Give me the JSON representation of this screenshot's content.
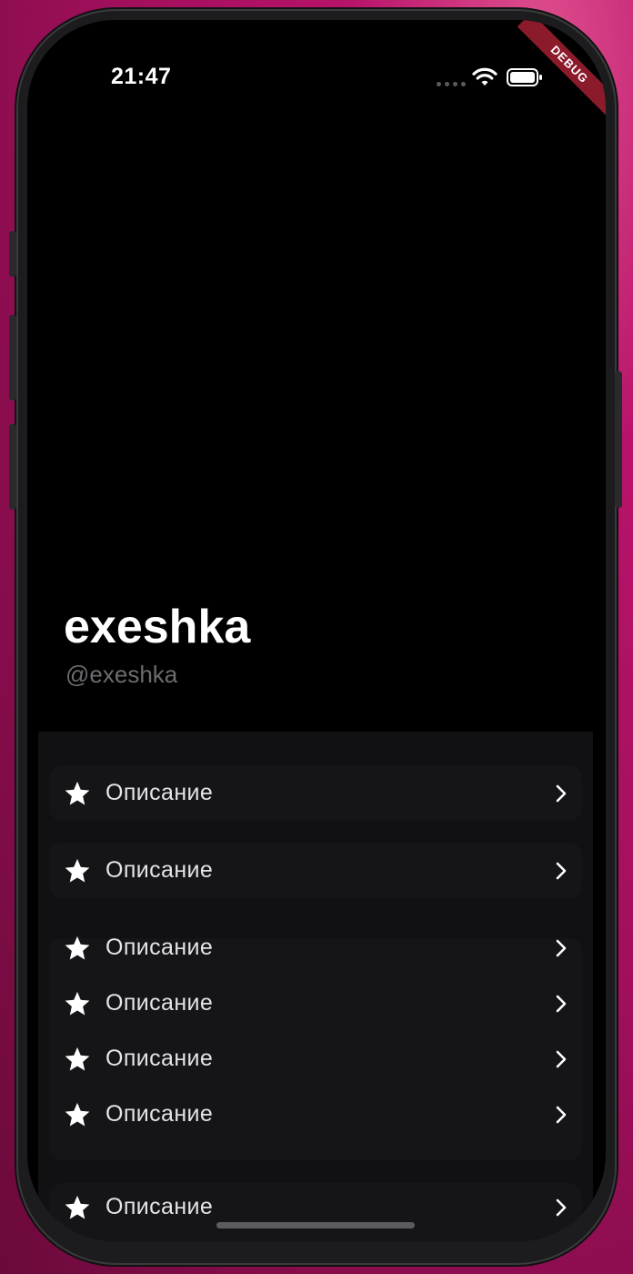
{
  "status_bar": {
    "time": "21:47"
  },
  "debug_banner": {
    "label": "DEBUG"
  },
  "profile": {
    "name": "exeshka",
    "handle": "@exeshka"
  },
  "menu": {
    "groups": [
      {
        "items": [
          {
            "icon": "star-icon",
            "label": "Описание"
          }
        ]
      },
      {
        "items": [
          {
            "icon": "star-icon",
            "label": "Описание"
          }
        ]
      },
      {
        "items": [
          {
            "icon": "star-icon",
            "label": "Описание"
          },
          {
            "icon": "star-icon",
            "label": "Описание"
          },
          {
            "icon": "star-icon",
            "label": "Описание"
          },
          {
            "icon": "star-icon",
            "label": "Описание"
          }
        ]
      },
      {
        "items": [
          {
            "icon": "star-icon",
            "label": "Описание"
          }
        ]
      }
    ]
  },
  "colors": {
    "background_accent": "#b8136a",
    "screen": "#000000",
    "panel": "#111113",
    "group": "#151517",
    "text_primary": "#ffffff",
    "text_secondary": "#6c6c70",
    "debug_ribbon": "#8b1a2b"
  }
}
